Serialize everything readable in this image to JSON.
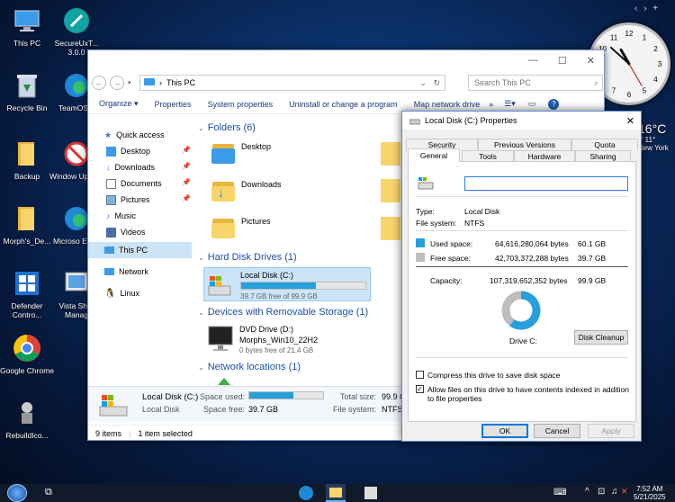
{
  "desktop": {
    "icons": [
      {
        "label": "This PC",
        "icon": "this-pc-icon"
      },
      {
        "label": "SecureUxT... 3.0.0",
        "icon": "secureux-icon"
      },
      {
        "label": "Recycle Bin",
        "icon": "recycle-bin-icon"
      },
      {
        "label": "TeamOS...",
        "icon": "edge-icon"
      },
      {
        "label": "Backup",
        "icon": "folder-icon"
      },
      {
        "label": "Window Update",
        "icon": "windows-update-icon"
      },
      {
        "label": "Morph's_De...",
        "icon": "folder-icon"
      },
      {
        "label": "Microso Edge",
        "icon": "edge-icon"
      },
      {
        "label": "Defender Contro...",
        "icon": "defender-icon"
      },
      {
        "label": "Vista Shor Manag",
        "icon": "vista-shortcut-icon"
      },
      {
        "label": "Google Chrome",
        "icon": "chrome-icon"
      },
      {
        "label": "RebuildIco...",
        "icon": "rebuild-icon"
      }
    ],
    "top_right_glyphs": "‹  ›  +",
    "weather": {
      "temp": "16°C",
      "range": "/° 11°",
      "city": "New York"
    }
  },
  "clock": {
    "numbers": [
      "12",
      "1",
      "2",
      "3",
      "4",
      "5",
      "6",
      "7",
      "8",
      "9",
      "10",
      "11"
    ]
  },
  "explorer": {
    "back_label": "←",
    "forward_label": "→",
    "address": "This PC",
    "address_prefix": "›",
    "search_placeholder": "Search This PC",
    "toolbar": [
      "Organize ▾",
      "Properties",
      "System properties",
      "Uninstall or change a program",
      "Map network drive",
      "»"
    ],
    "nav": {
      "quick_access": "Quick access",
      "items": [
        {
          "label": "Desktop",
          "pinned": true
        },
        {
          "label": "Downloads",
          "pinned": true
        },
        {
          "label": "Documents",
          "pinned": true
        },
        {
          "label": "Pictures",
          "pinned": true
        },
        {
          "label": "Music",
          "pinned": false
        },
        {
          "label": "Videos",
          "pinned": false
        }
      ],
      "this_pc": "This PC",
      "network": "Network",
      "linux": "Linux"
    },
    "sections": {
      "folders": "Folders (6)",
      "hard_disk": "Hard Disk Drives (1)",
      "removable": "Devices with Removable Storage (1)",
      "network": "Network locations (1)"
    },
    "folders": [
      "Desktop",
      "Downloads",
      "Pictures"
    ],
    "local_disk": {
      "name": "Local Disk (C:)",
      "free_text": "39.7 GB free of 99.9 GB",
      "used_fraction": 0.6
    },
    "dvd": {
      "name": "DVD Drive (D:)",
      "label": "Morphs_Win10_22H2",
      "free_text": "0 bytes free of 21.4 GB"
    },
    "details": {
      "name": "Local Disk (C:)",
      "type": "Local Disk",
      "space_used_label": "Space used:",
      "space_free_label": "Space free:",
      "space_free": "39.7 GB",
      "total_size_label": "Total size:",
      "total_size": "99.9 G",
      "filesystem_label": "File system:",
      "filesystem": "NTFS"
    },
    "status": {
      "items": "9 items",
      "selected": "1 item selected"
    }
  },
  "dialog": {
    "title": "Local Disk (C:) Properties",
    "tabs_row1": [
      "Security",
      "Previous Versions",
      "Quota"
    ],
    "tabs_row2": [
      "General",
      "Tools",
      "Hardware",
      "Sharing"
    ],
    "name_value": "",
    "type_label": "Type:",
    "type_value": "Local Disk",
    "fs_label": "File system:",
    "fs_value": "NTFS",
    "used_label": "Used space:",
    "used_bytes": "64,616,280,064 bytes",
    "used_gb": "60.1 GB",
    "free_label": "Free space:",
    "free_bytes": "42,703,372,288 bytes",
    "free_gb": "39.7 GB",
    "capacity_label": "Capacity:",
    "capacity_bytes": "107,319,652,352 bytes",
    "capacity_gb": "99.9 GB",
    "used_fraction": 0.602,
    "drive_label": "Drive C:",
    "cleanup": "Disk Cleanup",
    "compress": "Compress this drive to save disk space",
    "index": "Allow files on this drive to have contents indexed in addition to file properties",
    "ok": "OK",
    "cancel": "Cancel",
    "apply": "Apply",
    "colors": {
      "used": "#26a0da",
      "free": "#bebebe"
    }
  },
  "taskbar": {
    "time": "7:52 AM",
    "date": "5/21/2025"
  }
}
